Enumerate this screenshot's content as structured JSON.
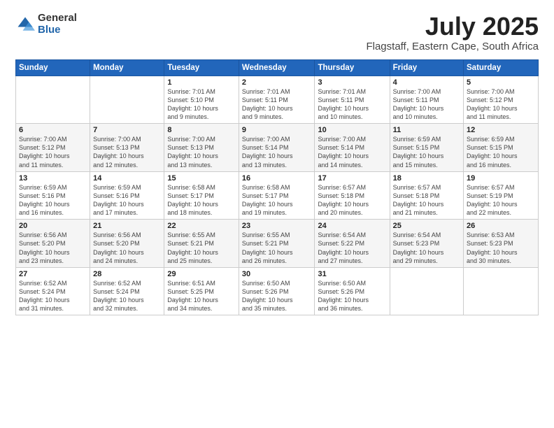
{
  "header": {
    "logo_general": "General",
    "logo_blue": "Blue",
    "title": "July 2025",
    "subtitle": "Flagstaff, Eastern Cape, South Africa"
  },
  "weekdays": [
    "Sunday",
    "Monday",
    "Tuesday",
    "Wednesday",
    "Thursday",
    "Friday",
    "Saturday"
  ],
  "weeks": [
    [
      {
        "day": "",
        "info": ""
      },
      {
        "day": "",
        "info": ""
      },
      {
        "day": "1",
        "info": "Sunrise: 7:01 AM\nSunset: 5:10 PM\nDaylight: 10 hours\nand 9 minutes."
      },
      {
        "day": "2",
        "info": "Sunrise: 7:01 AM\nSunset: 5:11 PM\nDaylight: 10 hours\nand 9 minutes."
      },
      {
        "day": "3",
        "info": "Sunrise: 7:01 AM\nSunset: 5:11 PM\nDaylight: 10 hours\nand 10 minutes."
      },
      {
        "day": "4",
        "info": "Sunrise: 7:00 AM\nSunset: 5:11 PM\nDaylight: 10 hours\nand 10 minutes."
      },
      {
        "day": "5",
        "info": "Sunrise: 7:00 AM\nSunset: 5:12 PM\nDaylight: 10 hours\nand 11 minutes."
      }
    ],
    [
      {
        "day": "6",
        "info": "Sunrise: 7:00 AM\nSunset: 5:12 PM\nDaylight: 10 hours\nand 11 minutes."
      },
      {
        "day": "7",
        "info": "Sunrise: 7:00 AM\nSunset: 5:13 PM\nDaylight: 10 hours\nand 12 minutes."
      },
      {
        "day": "8",
        "info": "Sunrise: 7:00 AM\nSunset: 5:13 PM\nDaylight: 10 hours\nand 13 minutes."
      },
      {
        "day": "9",
        "info": "Sunrise: 7:00 AM\nSunset: 5:14 PM\nDaylight: 10 hours\nand 13 minutes."
      },
      {
        "day": "10",
        "info": "Sunrise: 7:00 AM\nSunset: 5:14 PM\nDaylight: 10 hours\nand 14 minutes."
      },
      {
        "day": "11",
        "info": "Sunrise: 6:59 AM\nSunset: 5:15 PM\nDaylight: 10 hours\nand 15 minutes."
      },
      {
        "day": "12",
        "info": "Sunrise: 6:59 AM\nSunset: 5:15 PM\nDaylight: 10 hours\nand 16 minutes."
      }
    ],
    [
      {
        "day": "13",
        "info": "Sunrise: 6:59 AM\nSunset: 5:16 PM\nDaylight: 10 hours\nand 16 minutes."
      },
      {
        "day": "14",
        "info": "Sunrise: 6:59 AM\nSunset: 5:16 PM\nDaylight: 10 hours\nand 17 minutes."
      },
      {
        "day": "15",
        "info": "Sunrise: 6:58 AM\nSunset: 5:17 PM\nDaylight: 10 hours\nand 18 minutes."
      },
      {
        "day": "16",
        "info": "Sunrise: 6:58 AM\nSunset: 5:17 PM\nDaylight: 10 hours\nand 19 minutes."
      },
      {
        "day": "17",
        "info": "Sunrise: 6:57 AM\nSunset: 5:18 PM\nDaylight: 10 hours\nand 20 minutes."
      },
      {
        "day": "18",
        "info": "Sunrise: 6:57 AM\nSunset: 5:18 PM\nDaylight: 10 hours\nand 21 minutes."
      },
      {
        "day": "19",
        "info": "Sunrise: 6:57 AM\nSunset: 5:19 PM\nDaylight: 10 hours\nand 22 minutes."
      }
    ],
    [
      {
        "day": "20",
        "info": "Sunrise: 6:56 AM\nSunset: 5:20 PM\nDaylight: 10 hours\nand 23 minutes."
      },
      {
        "day": "21",
        "info": "Sunrise: 6:56 AM\nSunset: 5:20 PM\nDaylight: 10 hours\nand 24 minutes."
      },
      {
        "day": "22",
        "info": "Sunrise: 6:55 AM\nSunset: 5:21 PM\nDaylight: 10 hours\nand 25 minutes."
      },
      {
        "day": "23",
        "info": "Sunrise: 6:55 AM\nSunset: 5:21 PM\nDaylight: 10 hours\nand 26 minutes."
      },
      {
        "day": "24",
        "info": "Sunrise: 6:54 AM\nSunset: 5:22 PM\nDaylight: 10 hours\nand 27 minutes."
      },
      {
        "day": "25",
        "info": "Sunrise: 6:54 AM\nSunset: 5:23 PM\nDaylight: 10 hours\nand 29 minutes."
      },
      {
        "day": "26",
        "info": "Sunrise: 6:53 AM\nSunset: 5:23 PM\nDaylight: 10 hours\nand 30 minutes."
      }
    ],
    [
      {
        "day": "27",
        "info": "Sunrise: 6:52 AM\nSunset: 5:24 PM\nDaylight: 10 hours\nand 31 minutes."
      },
      {
        "day": "28",
        "info": "Sunrise: 6:52 AM\nSunset: 5:24 PM\nDaylight: 10 hours\nand 32 minutes."
      },
      {
        "day": "29",
        "info": "Sunrise: 6:51 AM\nSunset: 5:25 PM\nDaylight: 10 hours\nand 34 minutes."
      },
      {
        "day": "30",
        "info": "Sunrise: 6:50 AM\nSunset: 5:26 PM\nDaylight: 10 hours\nand 35 minutes."
      },
      {
        "day": "31",
        "info": "Sunrise: 6:50 AM\nSunset: 5:26 PM\nDaylight: 10 hours\nand 36 minutes."
      },
      {
        "day": "",
        "info": ""
      },
      {
        "day": "",
        "info": ""
      }
    ]
  ]
}
